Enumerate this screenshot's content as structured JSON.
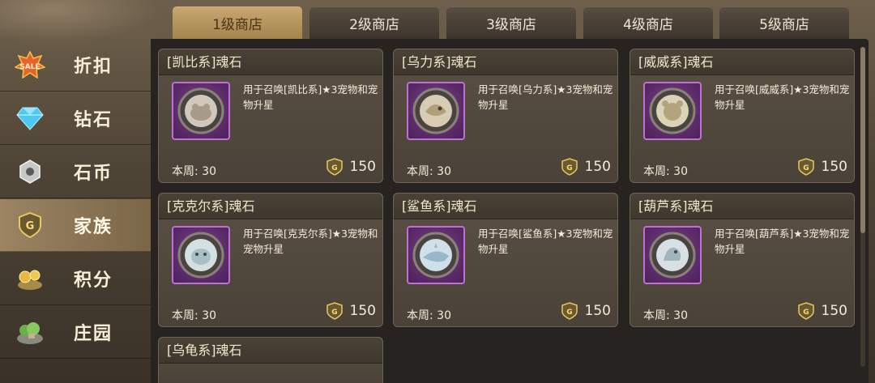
{
  "tabs": [
    {
      "label": "1级商店",
      "active": true
    },
    {
      "label": "2级商店",
      "active": false
    },
    {
      "label": "3级商店",
      "active": false
    },
    {
      "label": "4级商店",
      "active": false
    },
    {
      "label": "5级商店",
      "active": false
    }
  ],
  "sidebar": {
    "items": [
      {
        "label": "折扣",
        "icon": "sale-icon",
        "badge": "SALE"
      },
      {
        "label": "钻石",
        "icon": "diamond-icon"
      },
      {
        "label": "石币",
        "icon": "stone-coin-icon"
      },
      {
        "label": "家族",
        "icon": "guild-coin-icon",
        "badge": "G",
        "active": true
      },
      {
        "label": "积分",
        "icon": "points-icon"
      },
      {
        "label": "庄园",
        "icon": "manor-icon"
      }
    ]
  },
  "cards": [
    {
      "title": "[凯比系]魂石",
      "desc": "用于召唤[凯比系]★3宠物和宠物升星",
      "week": "本周: 30",
      "price": "150",
      "icon": "soulstone-kaibi-icon"
    },
    {
      "title": "[乌力系]魂石",
      "desc": "用于召唤[乌力系]★3宠物和宠物升星",
      "week": "本周: 30",
      "price": "150",
      "icon": "soulstone-wuli-icon"
    },
    {
      "title": "[威威系]魂石",
      "desc": "用于召唤[威威系]★3宠物和宠物升星",
      "week": "本周: 30",
      "price": "150",
      "icon": "soulstone-weiwei-icon"
    },
    {
      "title": "[克克尔系]魂石",
      "desc": "用于召唤[克克尔系]★3宠物和宠物升星",
      "week": "本周: 30",
      "price": "150",
      "icon": "soulstone-kekeer-icon"
    },
    {
      "title": "[鲨鱼系]魂石",
      "desc": "用于召唤[鲨鱼系]★3宠物和宠物升星",
      "week": "本周: 30",
      "price": "150",
      "icon": "soulstone-shark-icon"
    },
    {
      "title": "[葫芦系]魂石",
      "desc": "用于召唤[葫芦系]★3宠物和宠物升星",
      "week": "本周: 30",
      "price": "150",
      "icon": "soulstone-hulu-icon"
    },
    {
      "title": "[乌龟系]魂石",
      "desc": "",
      "week": "",
      "price": "",
      "icon": ""
    }
  ],
  "currency_badge": "G",
  "colors": {
    "active_tab": "#c8a870",
    "card_bg": "#5a5044",
    "icon_frame": "#c070d4",
    "panel_bg": "#262320"
  }
}
